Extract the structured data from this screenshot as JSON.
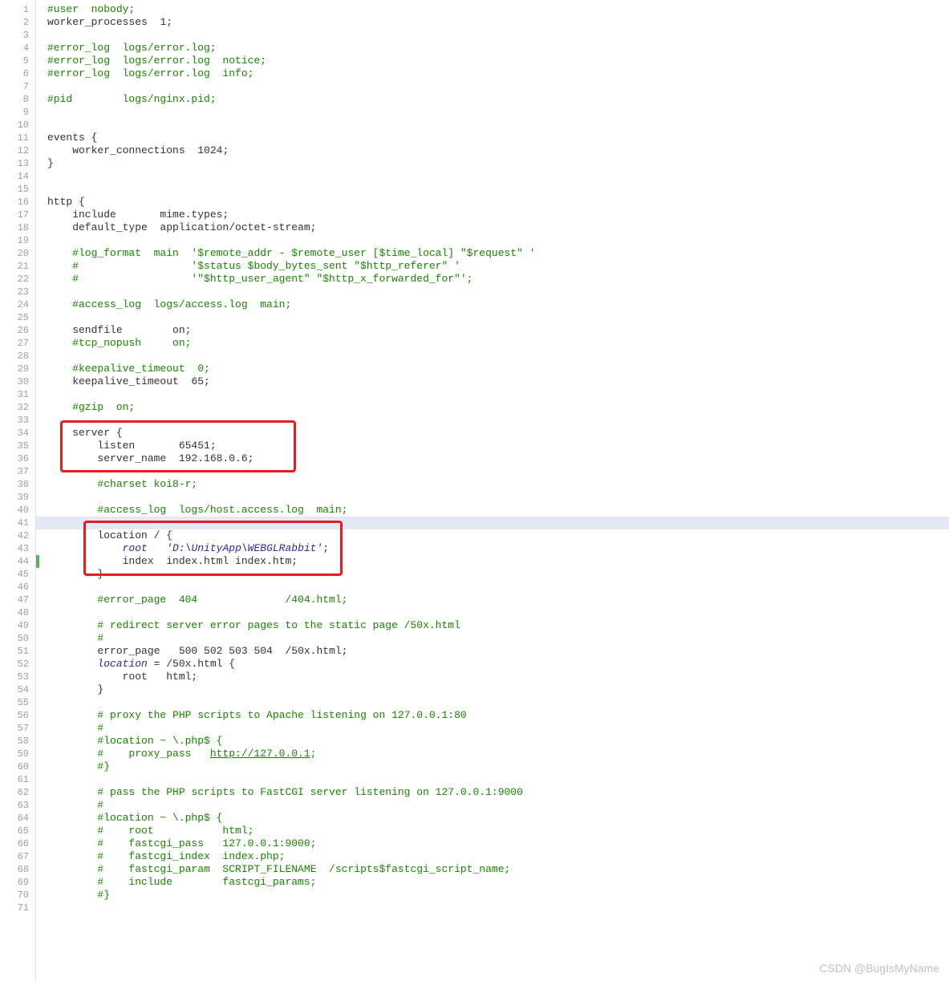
{
  "watermark": "CSDN @BugIsMyName",
  "highlight_row_index": 40,
  "green_marker_row_index": 43,
  "lines": [
    {
      "n": 1,
      "segs": [
        {
          "cls": "comment",
          "t": "#user  nobody;"
        }
      ]
    },
    {
      "n": 2,
      "segs": [
        {
          "cls": "plain",
          "t": "worker_processes  "
        },
        {
          "cls": "plain",
          "t": "1"
        },
        {
          "cls": "plain",
          "t": ";"
        }
      ]
    },
    {
      "n": 3,
      "segs": []
    },
    {
      "n": 4,
      "segs": [
        {
          "cls": "comment",
          "t": "#error_log  logs/error.log;"
        }
      ]
    },
    {
      "n": 5,
      "segs": [
        {
          "cls": "comment",
          "t": "#error_log  logs/error.log  notice;"
        }
      ]
    },
    {
      "n": 6,
      "segs": [
        {
          "cls": "comment",
          "t": "#error_log  logs/error.log  info;"
        }
      ]
    },
    {
      "n": 7,
      "segs": []
    },
    {
      "n": 8,
      "segs": [
        {
          "cls": "comment",
          "t": "#pid        logs/nginx.pid;"
        }
      ]
    },
    {
      "n": 9,
      "segs": []
    },
    {
      "n": 10,
      "segs": []
    },
    {
      "n": 11,
      "segs": [
        {
          "cls": "plain",
          "t": "events {"
        }
      ]
    },
    {
      "n": 12,
      "segs": [
        {
          "cls": "plain",
          "t": "    worker_connections  "
        },
        {
          "cls": "plain",
          "t": "1024"
        },
        {
          "cls": "plain",
          "t": ";"
        }
      ]
    },
    {
      "n": 13,
      "segs": [
        {
          "cls": "plain",
          "t": "}"
        }
      ]
    },
    {
      "n": 14,
      "segs": []
    },
    {
      "n": 15,
      "segs": []
    },
    {
      "n": 16,
      "segs": [
        {
          "cls": "plain",
          "t": "http {"
        }
      ]
    },
    {
      "n": 17,
      "segs": [
        {
          "cls": "plain",
          "t": "    include       mime.types;"
        }
      ]
    },
    {
      "n": 18,
      "segs": [
        {
          "cls": "plain",
          "t": "    default_type  application/octet-stream;"
        }
      ]
    },
    {
      "n": 19,
      "segs": []
    },
    {
      "n": 20,
      "segs": [
        {
          "cls": "comment",
          "t": "    #log_format  main  '$remote_addr - $remote_user [$time_local] \"$request\" '"
        }
      ]
    },
    {
      "n": 21,
      "segs": [
        {
          "cls": "comment",
          "t": "    #                  '$status $body_bytes_sent \"$http_referer\" '"
        }
      ]
    },
    {
      "n": 22,
      "segs": [
        {
          "cls": "comment",
          "t": "    #                  '\"$http_user_agent\" \"$http_x_forwarded_for\"';"
        }
      ]
    },
    {
      "n": 23,
      "segs": []
    },
    {
      "n": 24,
      "segs": [
        {
          "cls": "comment",
          "t": "    #access_log  logs/access.log  main;"
        }
      ]
    },
    {
      "n": 25,
      "segs": []
    },
    {
      "n": 26,
      "segs": [
        {
          "cls": "plain",
          "t": "    sendfile        on;"
        }
      ]
    },
    {
      "n": 27,
      "segs": [
        {
          "cls": "comment",
          "t": "    #tcp_nopush     on;"
        }
      ]
    },
    {
      "n": 28,
      "segs": []
    },
    {
      "n": 29,
      "segs": [
        {
          "cls": "comment",
          "t": "    #keepalive_timeout  0;"
        }
      ]
    },
    {
      "n": 30,
      "segs": [
        {
          "cls": "plain",
          "t": "    keepalive_timeout  "
        },
        {
          "cls": "plain",
          "t": "65"
        },
        {
          "cls": "plain",
          "t": ";"
        }
      ]
    },
    {
      "n": 31,
      "segs": []
    },
    {
      "n": 32,
      "segs": [
        {
          "cls": "comment",
          "t": "    #gzip  on;"
        }
      ]
    },
    {
      "n": 33,
      "segs": []
    },
    {
      "n": 34,
      "segs": [
        {
          "cls": "plain",
          "t": "    server {"
        }
      ]
    },
    {
      "n": 35,
      "segs": [
        {
          "cls": "plain",
          "t": "        listen       "
        },
        {
          "cls": "plain",
          "t": "65451"
        },
        {
          "cls": "plain",
          "t": ";"
        }
      ]
    },
    {
      "n": 36,
      "segs": [
        {
          "cls": "plain",
          "t": "        server_name  "
        },
        {
          "cls": "plain",
          "t": "192.168.0.6"
        },
        {
          "cls": "plain",
          "t": ";"
        }
      ]
    },
    {
      "n": 37,
      "segs": []
    },
    {
      "n": 38,
      "segs": [
        {
          "cls": "comment",
          "t": "        #charset koi8-r;"
        }
      ]
    },
    {
      "n": 39,
      "segs": []
    },
    {
      "n": 40,
      "segs": [
        {
          "cls": "comment",
          "t": "        #access_log  logs/host.access.log  main;"
        }
      ]
    },
    {
      "n": 41,
      "segs": []
    },
    {
      "n": 42,
      "segs": [
        {
          "cls": "plain",
          "t": "        location / {"
        }
      ]
    },
    {
      "n": 43,
      "segs": [
        {
          "cls": "plain",
          "t": "            "
        },
        {
          "cls": "kw",
          "t": "root"
        },
        {
          "cls": "plain",
          "t": "   "
        },
        {
          "cls": "kw",
          "t": "'D:\\UnityApp\\WEBGLRabbit'"
        },
        {
          "cls": "plain",
          "t": ";"
        }
      ]
    },
    {
      "n": 44,
      "segs": [
        {
          "cls": "plain",
          "t": "            index  index.html index.htm;"
        }
      ]
    },
    {
      "n": 45,
      "segs": [
        {
          "cls": "plain",
          "t": "        }"
        }
      ]
    },
    {
      "n": 46,
      "segs": []
    },
    {
      "n": 47,
      "segs": [
        {
          "cls": "comment",
          "t": "        #error_page  404              /404.html;"
        }
      ]
    },
    {
      "n": 48,
      "segs": []
    },
    {
      "n": 49,
      "segs": [
        {
          "cls": "comment",
          "t": "        # redirect server error pages to the static page /50x.html"
        }
      ]
    },
    {
      "n": 50,
      "segs": [
        {
          "cls": "comment",
          "t": "        #"
        }
      ]
    },
    {
      "n": 51,
      "segs": [
        {
          "cls": "plain",
          "t": "        error_page   "
        },
        {
          "cls": "plain",
          "t": "500 502 503 504"
        },
        {
          "cls": "plain",
          "t": "  /50x.html;"
        }
      ]
    },
    {
      "n": 52,
      "segs": [
        {
          "cls": "plain",
          "t": "        "
        },
        {
          "cls": "kw",
          "t": "location"
        },
        {
          "cls": "plain",
          "t": " = /50x.html {"
        }
      ]
    },
    {
      "n": 53,
      "segs": [
        {
          "cls": "plain",
          "t": "            root   html;"
        }
      ]
    },
    {
      "n": 54,
      "segs": [
        {
          "cls": "plain",
          "t": "        }"
        }
      ]
    },
    {
      "n": 55,
      "segs": []
    },
    {
      "n": 56,
      "segs": [
        {
          "cls": "comment",
          "t": "        # proxy the PHP scripts to Apache listening on 127.0.0.1:80"
        }
      ]
    },
    {
      "n": 57,
      "segs": [
        {
          "cls": "comment",
          "t": "        #"
        }
      ]
    },
    {
      "n": 58,
      "segs": [
        {
          "cls": "comment",
          "t": "        #location ~ \\.php$ {"
        }
      ]
    },
    {
      "n": 59,
      "segs": [
        {
          "cls": "comment",
          "t": "        #    proxy_pass   "
        },
        {
          "cls": "link",
          "t": "http://127.0.0.1"
        },
        {
          "cls": "comment",
          "t": ";"
        }
      ]
    },
    {
      "n": 60,
      "segs": [
        {
          "cls": "comment",
          "t": "        #}"
        }
      ]
    },
    {
      "n": 61,
      "segs": []
    },
    {
      "n": 62,
      "segs": [
        {
          "cls": "comment",
          "t": "        # pass the PHP scripts to FastCGI server listening on 127.0.0.1:9000"
        }
      ]
    },
    {
      "n": 63,
      "segs": [
        {
          "cls": "comment",
          "t": "        #"
        }
      ]
    },
    {
      "n": 64,
      "segs": [
        {
          "cls": "comment",
          "t": "        #location ~ \\.php$ {"
        }
      ]
    },
    {
      "n": 65,
      "segs": [
        {
          "cls": "comment",
          "t": "        #    root           html;"
        }
      ]
    },
    {
      "n": 66,
      "segs": [
        {
          "cls": "comment",
          "t": "        #    fastcgi_pass   127.0.0.1:9000;"
        }
      ]
    },
    {
      "n": 67,
      "segs": [
        {
          "cls": "comment",
          "t": "        #    fastcgi_index  index.php;"
        }
      ]
    },
    {
      "n": 68,
      "segs": [
        {
          "cls": "comment",
          "t": "        #    fastcgi_param  SCRIPT_FILENAME  /scripts$fastcgi_script_name;"
        }
      ]
    },
    {
      "n": 69,
      "segs": [
        {
          "cls": "comment",
          "t": "        #    include        fastcgi_params;"
        }
      ]
    },
    {
      "n": 70,
      "segs": [
        {
          "cls": "comment",
          "t": "        #}"
        }
      ]
    },
    {
      "n": 71,
      "segs": []
    }
  ]
}
